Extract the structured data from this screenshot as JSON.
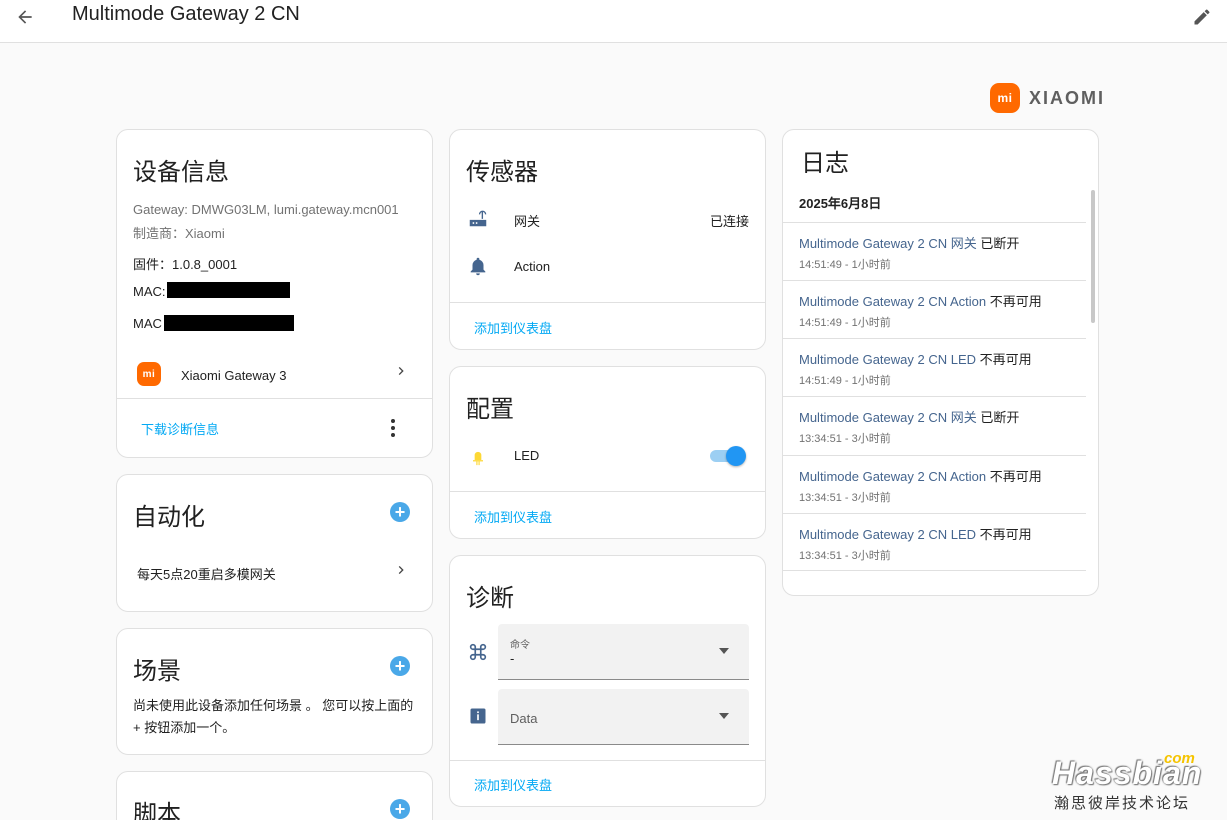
{
  "header": {
    "title": "Multimode Gateway 2 CN"
  },
  "brand": {
    "badge": "mi",
    "name": "XIAOMI",
    "color": "#ff6900"
  },
  "device_info": {
    "title": "设备信息",
    "model": "Gateway: DMWG03LM, lumi.gateway.mcn001",
    "manufacturer": "制造商：Xiaomi",
    "firmware": "固件：1.0.8_0001",
    "mac1": "MAC:",
    "mac2": "MAC",
    "parent_badge": "mi",
    "parent_name": "Xiaomi Gateway 3",
    "download": "下载诊断信息"
  },
  "automation": {
    "title": "自动化",
    "item": "每天5点20重启多模网关"
  },
  "scenes": {
    "title": "场景",
    "empty": "尚未使用此设备添加任何场景 。 您可以按上面的 + 按钮添加一个。"
  },
  "scripts": {
    "title": "脚本"
  },
  "sensors": {
    "title": "传感器",
    "rows": [
      {
        "icon": "router-icon",
        "name": "网关",
        "value": "已连接"
      },
      {
        "icon": "bell-icon",
        "name": "Action",
        "value": ""
      }
    ],
    "add": "添加到仪表盘"
  },
  "config": {
    "title": "配置",
    "led_label": "LED",
    "led_on": true,
    "add": "添加到仪表盘"
  },
  "diagnostics": {
    "title": "诊断",
    "command_label": "命令",
    "command_value": "-",
    "data_label": "Data",
    "add": "添加到仪表盘"
  },
  "logbook": {
    "title": "日志",
    "date": "2025年6月8日",
    "entries": [
      {
        "entity": "Multimode Gateway 2 CN 网关",
        "state": "已断开",
        "time": "14:51:49 - 1小时前"
      },
      {
        "entity": "Multimode Gateway 2 CN Action",
        "state": "不再可用",
        "time": "14:51:49 - 1小时前"
      },
      {
        "entity": "Multimode Gateway 2 CN LED",
        "state": "不再可用",
        "time": "14:51:49 - 1小时前"
      },
      {
        "entity": "Multimode Gateway 2 CN 网关",
        "state": "已断开",
        "time": "13:34:51 - 3小时前"
      },
      {
        "entity": "Multimode Gateway 2 CN Action",
        "state": "不再可用",
        "time": "13:34:51 - 3小时前"
      },
      {
        "entity": "Multimode Gateway 2 CN LED",
        "state": "不再可用",
        "time": "13:34:51 - 3小时前"
      }
    ]
  },
  "watermark": {
    "com": "com",
    "main": "Hassbian",
    "sub": "瀚思彼岸技术论坛"
  }
}
